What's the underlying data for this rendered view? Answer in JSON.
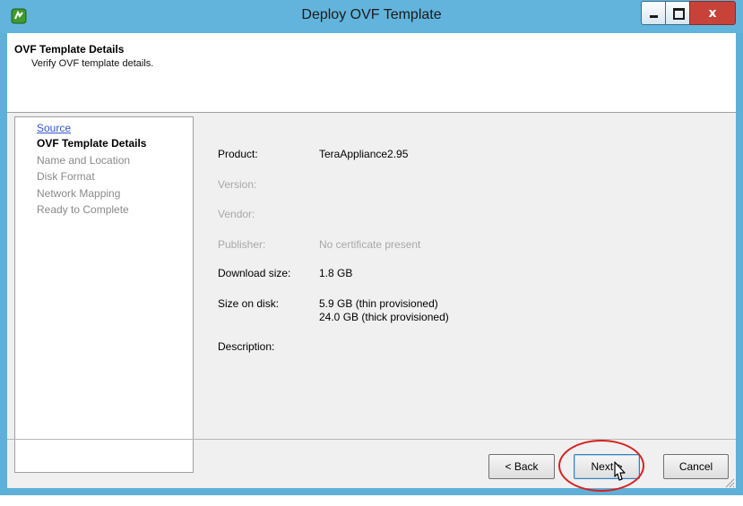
{
  "window": {
    "title": "Deploy OVF Template",
    "close_label": "x"
  },
  "header": {
    "title": "OVF Template Details",
    "subtitle": "Verify OVF template details."
  },
  "nav": {
    "items": [
      {
        "label": "Source",
        "state": "link"
      },
      {
        "label": "OVF Template Details",
        "state": "current"
      },
      {
        "label": "Name and Location",
        "state": "disabled"
      },
      {
        "label": "Disk Format",
        "state": "disabled"
      },
      {
        "label": "Network Mapping",
        "state": "disabled"
      },
      {
        "label": "Ready to Complete",
        "state": "disabled"
      }
    ]
  },
  "details": {
    "product": {
      "label": "Product:",
      "value": "TeraAppliance2.95"
    },
    "version": {
      "label": "Version:",
      "value": ""
    },
    "vendor": {
      "label": "Vendor:",
      "value": ""
    },
    "publisher": {
      "label": "Publisher:",
      "value": "No certificate present"
    },
    "download_size": {
      "label": "Download size:",
      "value": "1.8 GB"
    },
    "size_on_disk": {
      "label": "Size on disk:",
      "value_thin": "5.9 GB (thin provisioned)",
      "value_thick": "24.0 GB (thick provisioned)"
    },
    "description": {
      "label": "Description:",
      "value": ""
    }
  },
  "buttons": {
    "back": "< Back",
    "next": "Next >",
    "cancel": "Cancel"
  },
  "colors": {
    "titlebar": "#62b4dc",
    "close": "#c7433a",
    "highlight_ring": "#d82020",
    "link": "#3355cc"
  },
  "icons": {
    "app": "vsphere-app-icon",
    "cursor": "mouse-pointer-icon"
  }
}
